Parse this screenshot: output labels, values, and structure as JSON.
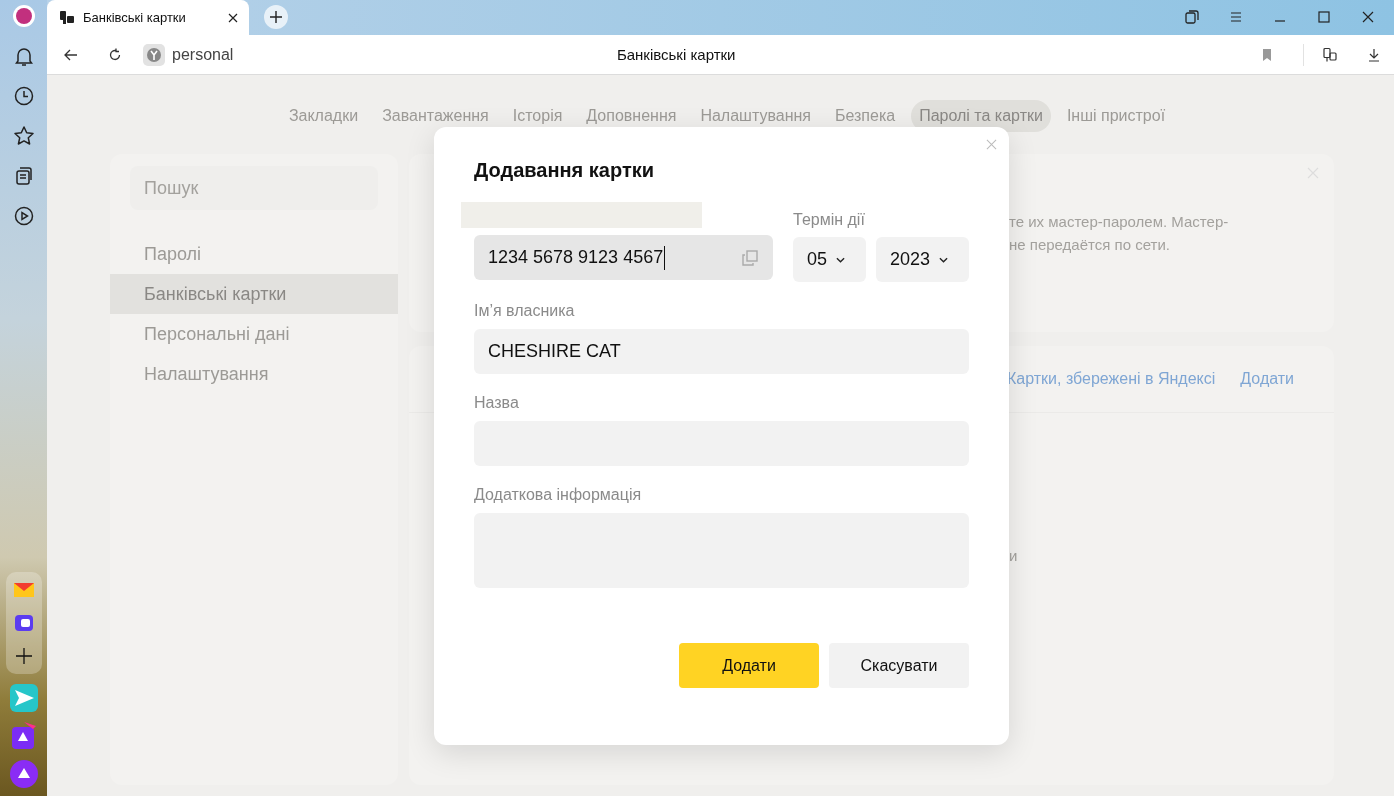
{
  "browser_tab": {
    "title": "Банківські картки",
    "selected": true
  },
  "address_bar": {
    "site": "personal",
    "page_title": "Банківські картки"
  },
  "settings_nav": [
    {
      "label": "Закладки",
      "selected": false
    },
    {
      "label": "Завантаження",
      "selected": false
    },
    {
      "label": "Історія",
      "selected": false
    },
    {
      "label": "Доповнення",
      "selected": false
    },
    {
      "label": "Налаштування",
      "selected": false
    },
    {
      "label": "Безпека",
      "selected": false
    },
    {
      "label": "Паролі та картки",
      "selected": true
    },
    {
      "label": "Інші пристрої",
      "selected": false
    }
  ],
  "sidebar": {
    "search": {
      "placeholder": "Пошук"
    },
    "items": [
      {
        "label": "Паролі",
        "selected": false
      },
      {
        "label": "Банківські картки",
        "selected": true
      },
      {
        "label": "Персональні дані",
        "selected": false
      },
      {
        "label": "Налаштування",
        "selected": false
      }
    ]
  },
  "notice": {
    "lines": [
      "те их мастер-паролем. Мастер-",
      "не передаётся по сети."
    ]
  },
  "cards_panel": {
    "links": [
      "Картки, збережені в Яндексі",
      "Додати"
    ],
    "fragment": "и"
  },
  "dialog": {
    "title": "Додавання картки",
    "card_number": {
      "value": "1234 5678 9123 4567",
      "focused": true
    },
    "expiry": {
      "label": "Термін дії",
      "month": "05",
      "year": "2023"
    },
    "fields": [
      {
        "label": "Ім’я власника",
        "value": "CHESHIRE CAT",
        "kind": "line"
      },
      {
        "label": "Назва",
        "kind": "line"
      },
      {
        "label": "Додаткова інформація",
        "kind": "area"
      }
    ],
    "buttons": [
      {
        "label": "Додати",
        "kind": "primary"
      },
      {
        "label": "Скасувати",
        "kind": "secondary"
      }
    ]
  }
}
